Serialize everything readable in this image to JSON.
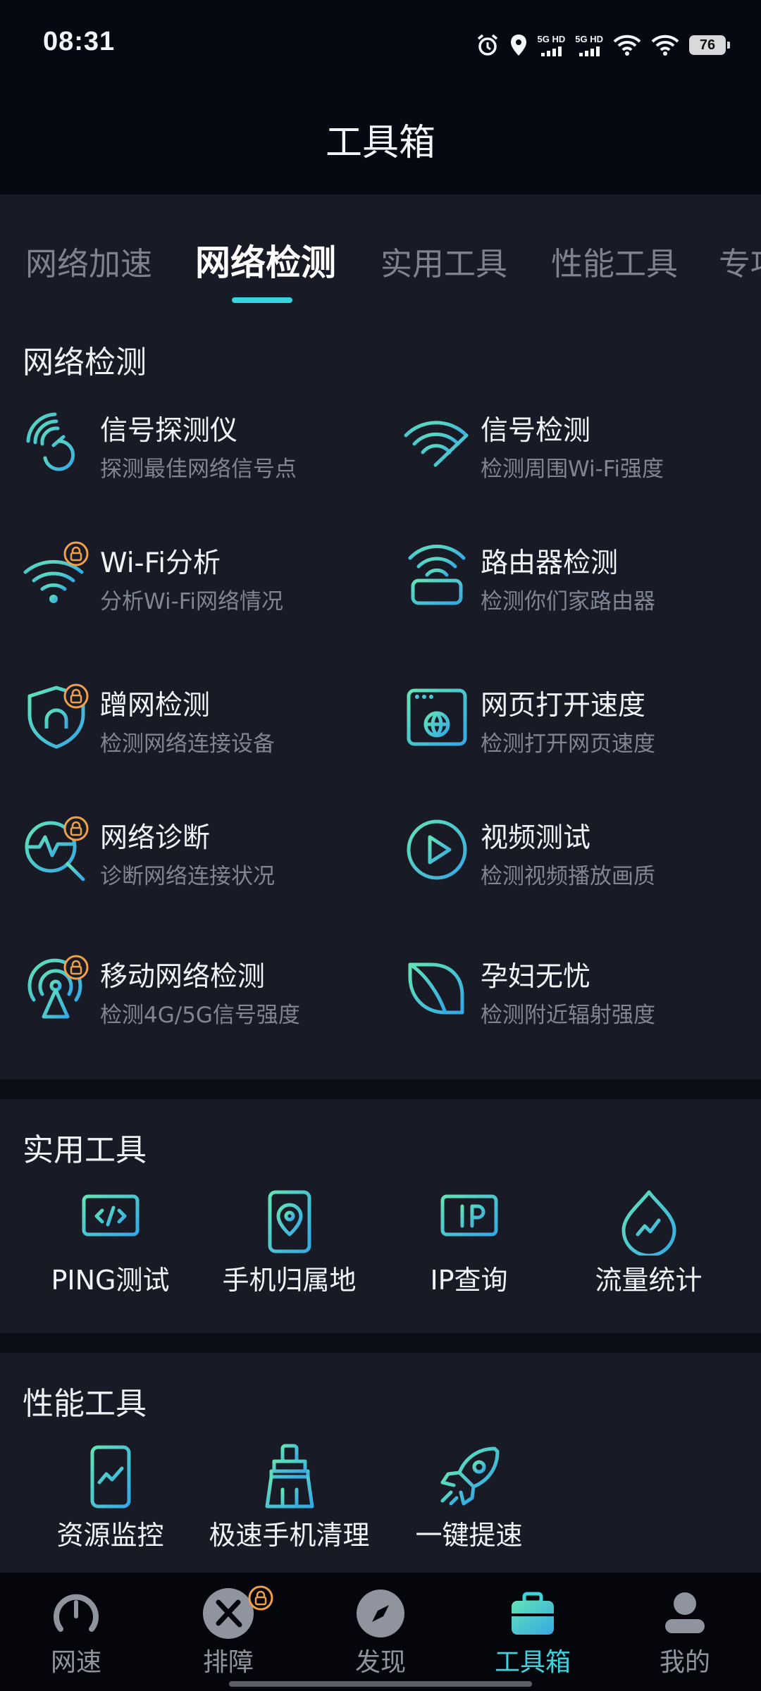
{
  "status_bar": {
    "time": "08:31",
    "net1": "5G HD",
    "net2": "5G HD",
    "battery": "76"
  },
  "header": {
    "title": "工具箱"
  },
  "tabs": [
    {
      "label": "网络加速",
      "active": false
    },
    {
      "label": "网络检测",
      "active": true
    },
    {
      "label": "实用工具",
      "active": false
    },
    {
      "label": "性能工具",
      "active": false
    },
    {
      "label": "专项",
      "active": false
    }
  ],
  "network_section": {
    "title": "网络检测",
    "items": [
      {
        "name": "信号探测仪",
        "desc": "探测最佳网络信号点",
        "icon": "signal-radar-icon",
        "locked": false
      },
      {
        "name": "信号检测",
        "desc": "检测周围Wi-Fi强度",
        "icon": "wifi-signal-icon",
        "locked": false
      },
      {
        "name": "Wi-Fi分析",
        "desc": "分析Wi-Fi网络情况",
        "icon": "wifi-icon",
        "locked": true
      },
      {
        "name": "路由器检测",
        "desc": "检测你们家路由器",
        "icon": "router-icon",
        "locked": false
      },
      {
        "name": "蹭网检测",
        "desc": "检测网络连接设备",
        "icon": "shield-alarm-icon",
        "locked": true
      },
      {
        "name": "网页打开速度",
        "desc": "检测打开网页速度",
        "icon": "browser-globe-icon",
        "locked": false
      },
      {
        "name": "网络诊断",
        "desc": "诊断网络连接状况",
        "icon": "diagnosis-magnifier-icon",
        "locked": true
      },
      {
        "name": "视频测试",
        "desc": "检测视频播放画质",
        "icon": "play-circle-icon",
        "locked": false
      },
      {
        "name": "移动网络检测",
        "desc": "检测4G/5G信号强度",
        "icon": "cell-tower-icon",
        "locked": true
      },
      {
        "name": "孕妇无忧",
        "desc": "检测附近辐射强度",
        "icon": "leaf-icon",
        "locked": false
      }
    ]
  },
  "utility_section": {
    "title": "实用工具",
    "items": [
      {
        "name": "PING测试",
        "icon": "code-monitor-icon"
      },
      {
        "name": "手机归属地",
        "icon": "phone-location-icon"
      },
      {
        "name": "IP查询",
        "icon": "ip-monitor-icon"
      },
      {
        "name": "流量统计",
        "icon": "traffic-drop-icon"
      }
    ]
  },
  "performance_section": {
    "title": "性能工具",
    "items": [
      {
        "name": "资源监控",
        "icon": "phone-chart-icon"
      },
      {
        "name": "极速手机清理",
        "icon": "broom-icon"
      },
      {
        "name": "一键提速",
        "icon": "rocket-icon"
      }
    ]
  },
  "bottom_nav": [
    {
      "label": "网速",
      "icon": "speedometer-icon",
      "active": false,
      "locked": false
    },
    {
      "label": "排障",
      "icon": "tools-icon",
      "active": false,
      "locked": true
    },
    {
      "label": "发现",
      "icon": "compass-icon",
      "active": false,
      "locked": false
    },
    {
      "label": "工具箱",
      "icon": "toolbox-icon",
      "active": true,
      "locked": false
    },
    {
      "label": "我的",
      "icon": "profile-icon",
      "active": false,
      "locked": false
    }
  ],
  "colors": {
    "accent": "#36d4df",
    "accent_green": "#5ee0b8",
    "lock": "#f0a04b",
    "background": "#181b26"
  }
}
